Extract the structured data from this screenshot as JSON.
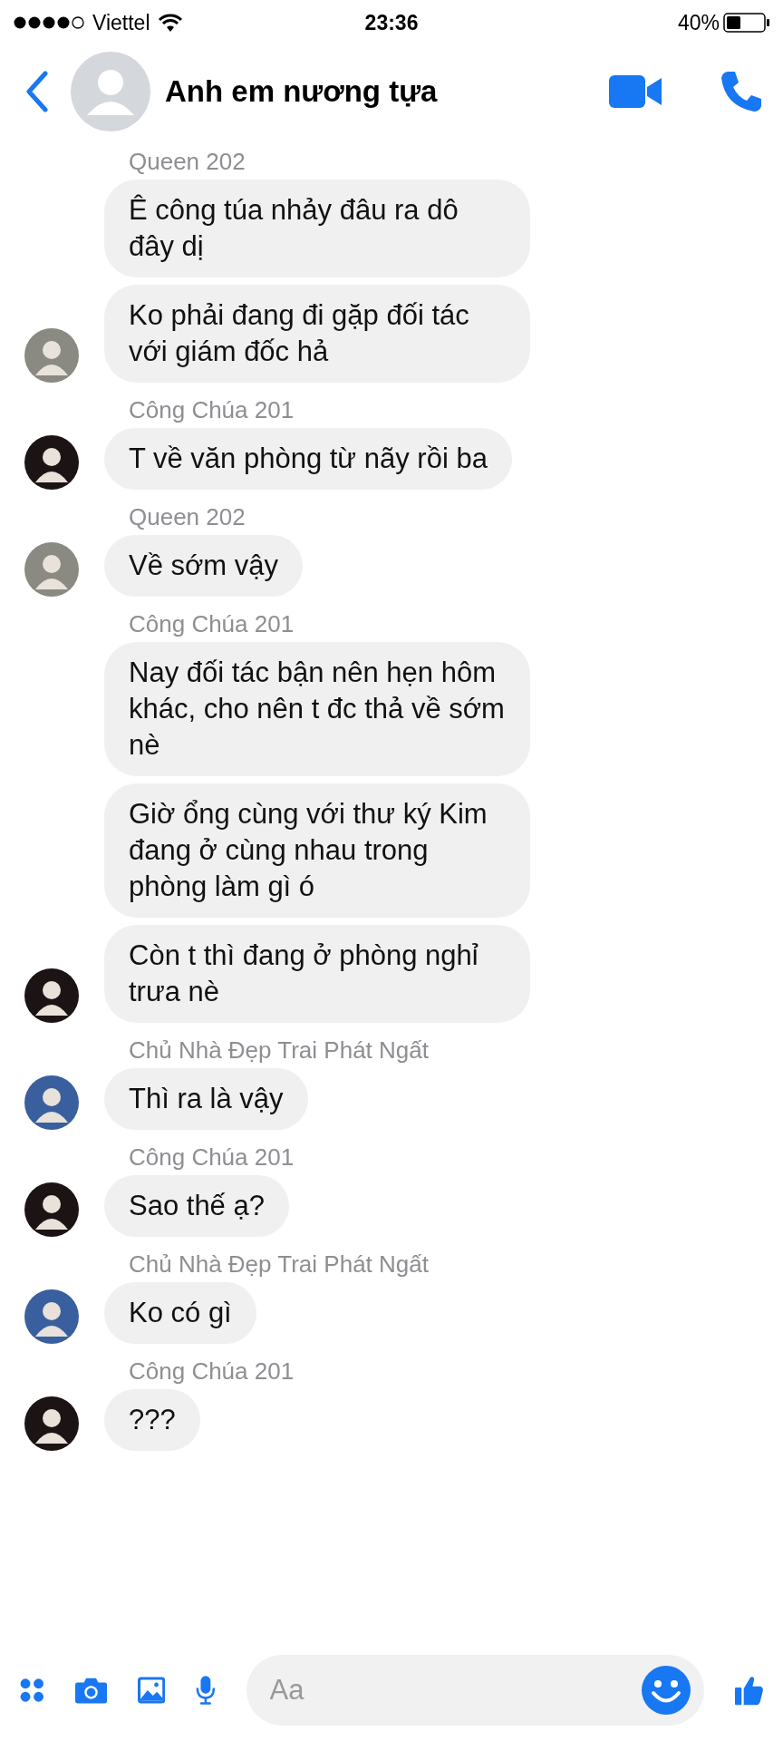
{
  "status_bar": {
    "carrier": "Viettel",
    "time": "23:36",
    "battery": "40%"
  },
  "header": {
    "title": "Anh em nương tựa"
  },
  "groups": [
    {
      "sender": "Queen 202",
      "color": "#8a8a82",
      "messages": [
        "Ê công túa nhảy đâu ra dô đây dị",
        "Ko phải đang đi gặp đối tác với giám đốc hả"
      ]
    },
    {
      "sender": "Công Chúa 201",
      "color": "#1c1414",
      "messages": [
        "T về văn phòng từ nãy rồi ba"
      ]
    },
    {
      "sender": "Queen 202",
      "color": "#8a8a82",
      "messages": [
        "Về sớm vậy"
      ]
    },
    {
      "sender": "Công Chúa 201",
      "color": "#1c1414",
      "messages": [
        "Nay đối tác bận nên hẹn hôm khác, cho nên t đc thả về sớm nè",
        "Giờ ổng cùng với thư ký Kim đang ở cùng nhau trong phòng làm gì ó",
        "Còn t thì đang ở phòng nghỉ trưa nè"
      ]
    },
    {
      "sender": "Chủ Nhà Đẹp Trai Phát Ngất",
      "color": "#3a5f9e",
      "messages": [
        "Thì ra là vậy"
      ]
    },
    {
      "sender": "Công Chúa 201",
      "color": "#1c1414",
      "messages": [
        "Sao thế ạ?"
      ]
    },
    {
      "sender": "Chủ Nhà Đẹp Trai Phát Ngất",
      "color": "#3a5f9e",
      "messages": [
        "Ko có gì"
      ]
    },
    {
      "sender": "Công Chúa 201",
      "color": "#1c1414",
      "messages": [
        "???"
      ]
    }
  ],
  "composer": {
    "placeholder": "Aa"
  }
}
